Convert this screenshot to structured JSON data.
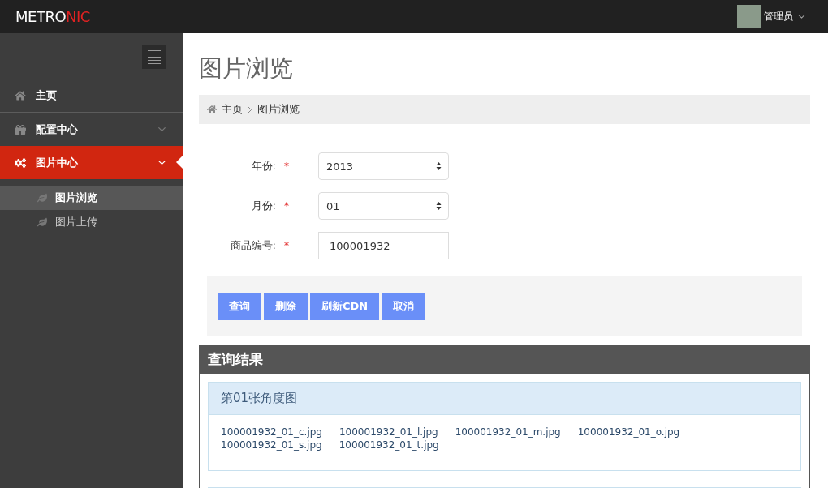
{
  "header": {
    "logo": {
      "text": "METRO",
      "accent": "NIC"
    },
    "user": {
      "name": "管理员"
    }
  },
  "sidebar": {
    "items": [
      {
        "label": "主页",
        "selected": false
      },
      {
        "label": "配置中心",
        "selected": false
      },
      {
        "label": "图片中心",
        "selected": true,
        "expanded": true,
        "children": [
          {
            "label": "图片浏览",
            "selected": true
          },
          {
            "label": "图片上传",
            "selected": false
          }
        ]
      }
    ]
  },
  "page": {
    "title": "图片浏览",
    "breadcrumb": [
      "主页",
      "图片浏览"
    ]
  },
  "form": {
    "fields": [
      {
        "label": "年份:",
        "required": "*",
        "kind": "select",
        "value": "2013"
      },
      {
        "label": "月份:",
        "required": "*",
        "kind": "select",
        "value": "01"
      },
      {
        "label": "商品编号:",
        "required": "*",
        "kind": "text",
        "value": "100001932"
      }
    ],
    "buttons": [
      "查询",
      "删除",
      "刷新CDN",
      "取消"
    ]
  },
  "results": {
    "title": "查询结果",
    "groups": [
      {
        "title": "第01张角度图",
        "files": [
          "100001932_01_c.jpg",
          "100001932_01_l.jpg",
          "100001932_01_m.jpg",
          "100001932_01_o.jpg",
          "100001932_01_s.jpg",
          "100001932_01_t.jpg"
        ]
      }
    ]
  }
}
